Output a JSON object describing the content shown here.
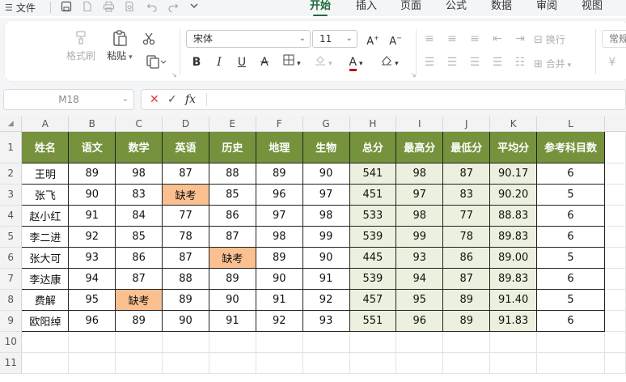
{
  "menu": {
    "file_label": "文件",
    "hamburger_glyph": "☰",
    "tabs": [
      "开始",
      "插入",
      "页面",
      "公式",
      "数据",
      "审阅",
      "视图"
    ],
    "active_tab": "开始",
    "accent_color": "#1d6b3a"
  },
  "ribbon": {
    "format_painter": "格式刷",
    "paste": "粘贴",
    "font_name": "宋体",
    "font_size": "11",
    "wrap": "换行",
    "merge": "合并",
    "number_format_partial": "常规",
    "currency_glyph": "¥"
  },
  "formula_bar": {
    "name_box": "M18",
    "cancel_glyph": "✕",
    "confirm_glyph": "✓",
    "fx_label": "fx",
    "content": ""
  },
  "sheet": {
    "columns": [
      "A",
      "B",
      "C",
      "D",
      "E",
      "F",
      "G",
      "H",
      "I",
      "J",
      "K",
      "L"
    ],
    "row_numbers": [
      "1",
      "2",
      "3",
      "4",
      "5",
      "6",
      "7",
      "8",
      "9",
      "10",
      "11"
    ],
    "headers": [
      "姓名",
      "语文",
      "数学",
      "英语",
      "历史",
      "地理",
      "生物",
      "总分",
      "最高分",
      "最低分",
      "平均分",
      "参考科目数"
    ],
    "rows": [
      [
        "王明",
        "89",
        "98",
        "87",
        "88",
        "89",
        "90",
        "541",
        "98",
        "87",
        "90.17",
        "6"
      ],
      [
        "张飞",
        "90",
        "83",
        "缺考",
        "85",
        "96",
        "97",
        "451",
        "97",
        "83",
        "90.20",
        "5"
      ],
      [
        "赵小红",
        "91",
        "84",
        "77",
        "86",
        "97",
        "98",
        "533",
        "98",
        "77",
        "88.83",
        "6"
      ],
      [
        "李二进",
        "92",
        "85",
        "78",
        "87",
        "98",
        "99",
        "539",
        "99",
        "78",
        "89.83",
        "6"
      ],
      [
        "张大可",
        "93",
        "86",
        "87",
        "缺考",
        "89",
        "90",
        "445",
        "93",
        "86",
        "89.00",
        "5"
      ],
      [
        "李达康",
        "94",
        "87",
        "88",
        "89",
        "90",
        "91",
        "539",
        "94",
        "87",
        "89.83",
        "6"
      ],
      [
        "费解",
        "95",
        "缺考",
        "89",
        "90",
        "91",
        "92",
        "457",
        "95",
        "89",
        "91.40",
        "5"
      ],
      [
        "欧阳绰",
        "96",
        "89",
        "90",
        "91",
        "92",
        "93",
        "551",
        "96",
        "89",
        "91.83",
        "6"
      ]
    ],
    "colors": {
      "header_bg": "#76923c",
      "header_text": "#ffffff",
      "calc_bg": "#ebf1de",
      "absent_bg": "#fac090"
    }
  }
}
